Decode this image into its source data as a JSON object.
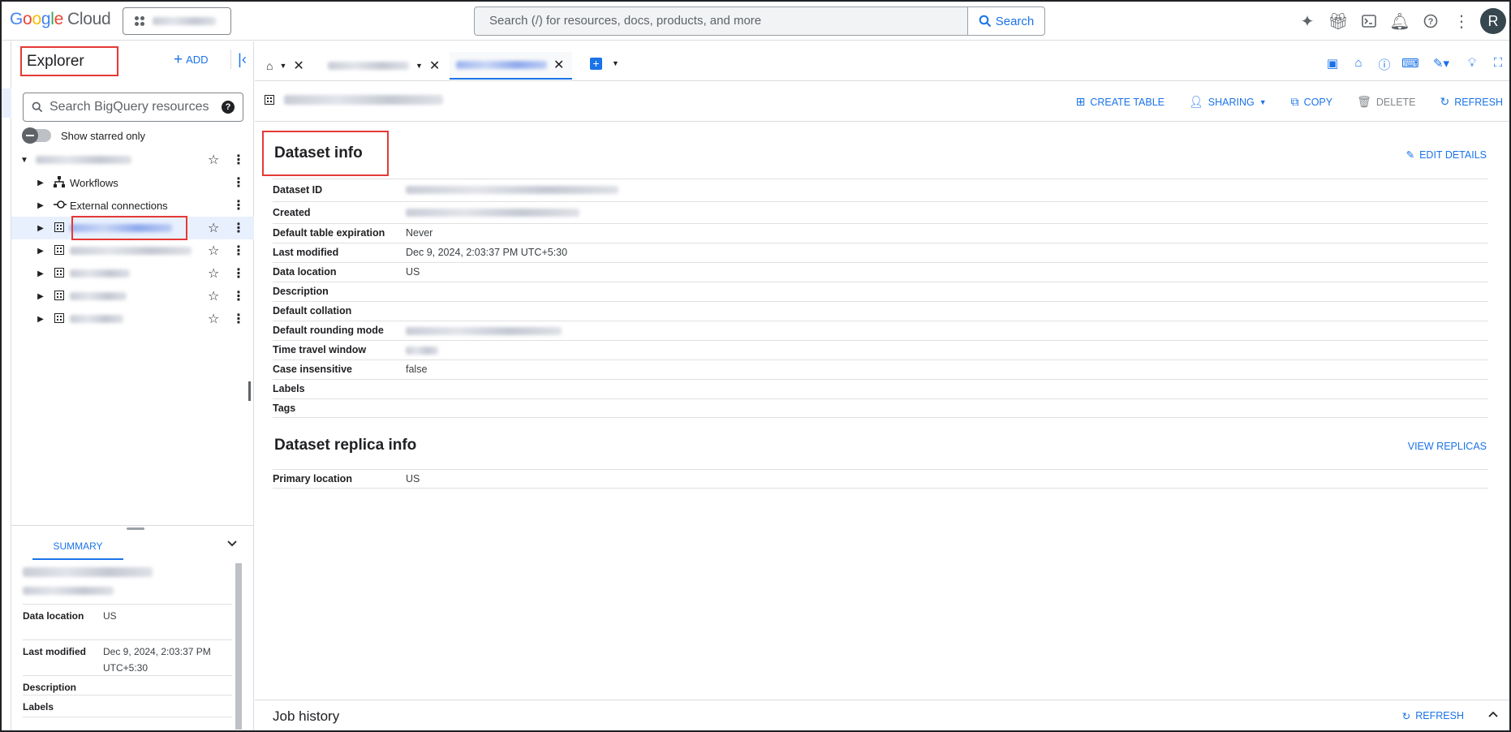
{
  "topbar": {
    "logo_parts": [
      "G",
      "o",
      "o",
      "g",
      "l",
      "e"
    ],
    "logo_cloud": "Cloud",
    "search_placeholder": "Search (/) for resources, docs, products, and more",
    "search_button": "Search",
    "avatar_letter": "R"
  },
  "explorer": {
    "title": "Explorer",
    "add_label": "ADD",
    "search_placeholder": "Search BigQuery resources",
    "starred_label": "Show starred only",
    "tree_items": [
      {
        "label": "Workflows"
      },
      {
        "label": "External connections"
      }
    ]
  },
  "summary": {
    "tab_label": "SUMMARY",
    "rows": [
      {
        "key": "Data location",
        "value": "US"
      },
      {
        "key": "Last modified",
        "value": "Dec 9, 2024, 2:03:37 PM UTC+5:30"
      },
      {
        "key": "Description",
        "value": ""
      },
      {
        "key": "Labels",
        "value": ""
      }
    ]
  },
  "actions": {
    "create_table": "CREATE TABLE",
    "sharing": "SHARING",
    "copy": "COPY",
    "delete": "DELETE",
    "refresh": "REFRESH"
  },
  "dataset_info": {
    "title": "Dataset info",
    "edit_details": "EDIT DETAILS",
    "rows": [
      {
        "key": "Dataset ID",
        "value": ""
      },
      {
        "key": "Created",
        "value": ""
      },
      {
        "key": "Default table expiration",
        "value": "Never"
      },
      {
        "key": "Last modified",
        "value": "Dec 9, 2024, 2:03:37 PM UTC+5:30"
      },
      {
        "key": "Data location",
        "value": "US"
      },
      {
        "key": "Description",
        "value": ""
      },
      {
        "key": "Default collation",
        "value": ""
      },
      {
        "key": "Default rounding mode",
        "value": ""
      },
      {
        "key": "Time travel window",
        "value": ""
      },
      {
        "key": "Case insensitive",
        "value": "false"
      },
      {
        "key": "Labels",
        "value": ""
      },
      {
        "key": "Tags",
        "value": ""
      }
    ]
  },
  "replica_info": {
    "title": "Dataset replica info",
    "view_replicas": "VIEW REPLICAS",
    "rows": [
      {
        "key": "Primary location",
        "value": "US"
      }
    ]
  },
  "job_history": {
    "title": "Job history",
    "refresh": "REFRESH"
  },
  "colors": {
    "accent": "#1a73e8",
    "highlight_box": "#e53935"
  }
}
